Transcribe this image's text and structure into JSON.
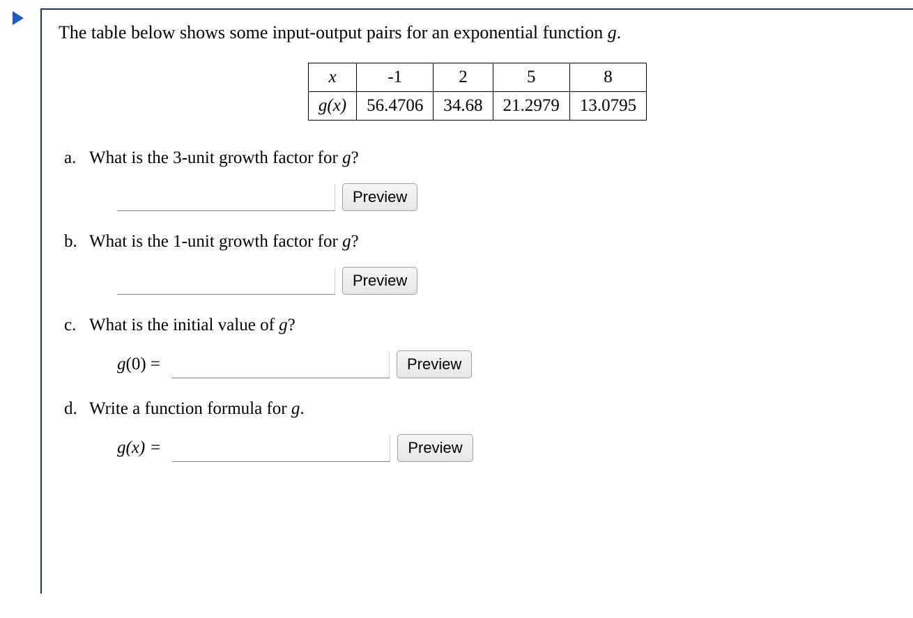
{
  "intro_prefix": "The table below shows some input-output pairs for an exponential function ",
  "intro_var": "g",
  "intro_suffix": ".",
  "table": {
    "row1_label_var": "x",
    "row2_label_g": "g",
    "row2_label_paren": "(x)",
    "cols": [
      "-1",
      "2",
      "5",
      "8"
    ],
    "vals": [
      "56.4706",
      "34.68",
      "21.2979",
      "13.0795"
    ]
  },
  "parts": {
    "a": {
      "marker": "a.",
      "text_prefix": "What is the 3-unit growth factor for ",
      "text_var": "g",
      "text_suffix": "?"
    },
    "b": {
      "marker": "b.",
      "text_prefix": "What is the 1-unit growth factor for ",
      "text_var": "g",
      "text_suffix": "?"
    },
    "c": {
      "marker": "c.",
      "text_prefix": "What is the initial value of ",
      "text_var": "g",
      "text_suffix": "?",
      "label_g": "g",
      "label_arg": "(0) = "
    },
    "d": {
      "marker": "d.",
      "text_prefix": "Write a function formula for ",
      "text_var": "g",
      "text_suffix": ".",
      "label_g": "g",
      "label_arg": "(x) = "
    }
  },
  "preview_label": "Preview"
}
